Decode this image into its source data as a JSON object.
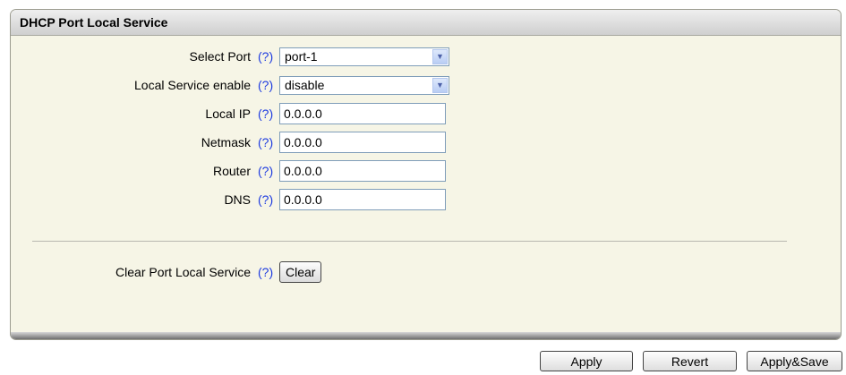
{
  "panel": {
    "title": "DHCP Port Local Service"
  },
  "help_text": "(?)",
  "form": {
    "select_port": {
      "label": "Select Port",
      "value": "port-1"
    },
    "local_service_enable": {
      "label": "Local Service enable",
      "value": "disable"
    },
    "local_ip": {
      "label": "Local IP",
      "value": "0.0.0.0"
    },
    "netmask": {
      "label": "Netmask",
      "value": "0.0.0.0"
    },
    "router": {
      "label": "Router",
      "value": "0.0.0.0"
    },
    "dns": {
      "label": "DNS",
      "value": "0.0.0.0"
    },
    "clear": {
      "label": "Clear Port Local Service",
      "button": "Clear"
    }
  },
  "actions": {
    "apply": "Apply",
    "revert": "Revert",
    "apply_save": "Apply&Save"
  },
  "icons": {
    "dropdown": "chevron-down-icon"
  },
  "colors": {
    "panel_bg": "#f6f5e6",
    "help_link": "#1d3be0",
    "header_bg": "#dcdcdc"
  }
}
